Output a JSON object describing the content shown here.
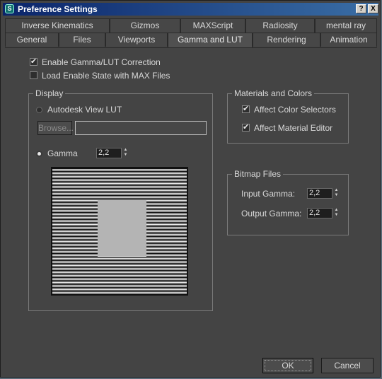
{
  "window": {
    "title": "Preference Settings",
    "help_label": "?",
    "close_label": "X"
  },
  "tabs_row1": [
    "Inverse Kinematics",
    "Gizmos",
    "MAXScript",
    "Radiosity",
    "mental ray"
  ],
  "tabs_row2": [
    "General",
    "Files",
    "Viewports",
    "Gamma and LUT",
    "Rendering",
    "Animation"
  ],
  "active_tab": "Gamma and LUT",
  "options": {
    "enable_gamma": {
      "label": "Enable Gamma/LUT Correction",
      "checked": true
    },
    "load_state": {
      "label": "Load Enable State with MAX Files",
      "checked": false
    }
  },
  "display": {
    "legend": "Display",
    "lut_label": "Autodesk View LUT",
    "browse_label": "Browse...",
    "lut_path": "",
    "gamma_label": "Gamma",
    "gamma_value": "2,2"
  },
  "materials": {
    "legend": "Materials and Colors",
    "affect_color": {
      "label": "Affect Color Selectors",
      "checked": true
    },
    "affect_material": {
      "label": "Affect Material Editor",
      "checked": true
    }
  },
  "bitmap": {
    "legend": "Bitmap Files",
    "input_label": "Input Gamma:",
    "input_value": "2,2",
    "output_label": "Output Gamma:",
    "output_value": "2,2"
  },
  "buttons": {
    "ok": "OK",
    "cancel": "Cancel"
  }
}
